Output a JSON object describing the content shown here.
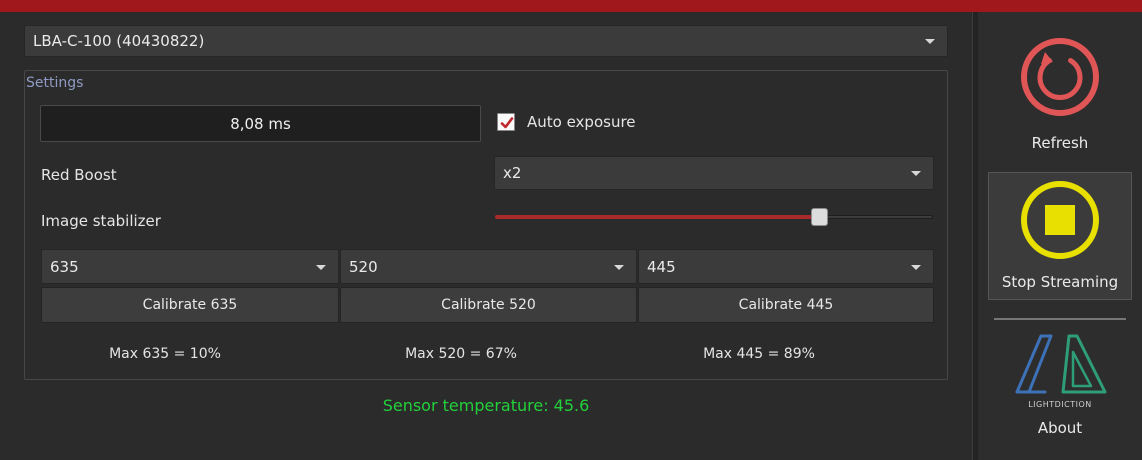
{
  "device": {
    "selected": "LBA-C-100 (40430822)"
  },
  "settings": {
    "group_title": "Settings",
    "exposure_value": "8,08 ms",
    "auto_exposure_label": "Auto exposure",
    "auto_exposure_checked": true,
    "red_boost_label": "Red Boost",
    "red_boost_value": "x2",
    "image_stabilizer_label": "Image stabilizer",
    "image_stabilizer_level": 0.74
  },
  "channels": [
    {
      "wavelength": "635",
      "calibrate_label": "Calibrate 635",
      "max_label": "Max 635 = 10%"
    },
    {
      "wavelength": "520",
      "calibrate_label": "Calibrate 520",
      "max_label": "Max 520 = 67%"
    },
    {
      "wavelength": "445",
      "calibrate_label": "Calibrate 445",
      "max_label": "Max 445 = 89%"
    }
  ],
  "status": {
    "sensor_temperature": "Sensor temperature: 45.6"
  },
  "sidebar": {
    "refresh_label": "Refresh",
    "stop_label": "Stop Streaming",
    "logo_text": "LIGHTDICTION",
    "about_label": "About"
  },
  "colors": {
    "brand_red": "#a1181c",
    "refresh_icon": "#e05555",
    "stop_icon": "#e8e000",
    "temperature_text": "#22d13a",
    "logo_blue": "#3d72b8",
    "logo_green": "#2e9e78"
  }
}
